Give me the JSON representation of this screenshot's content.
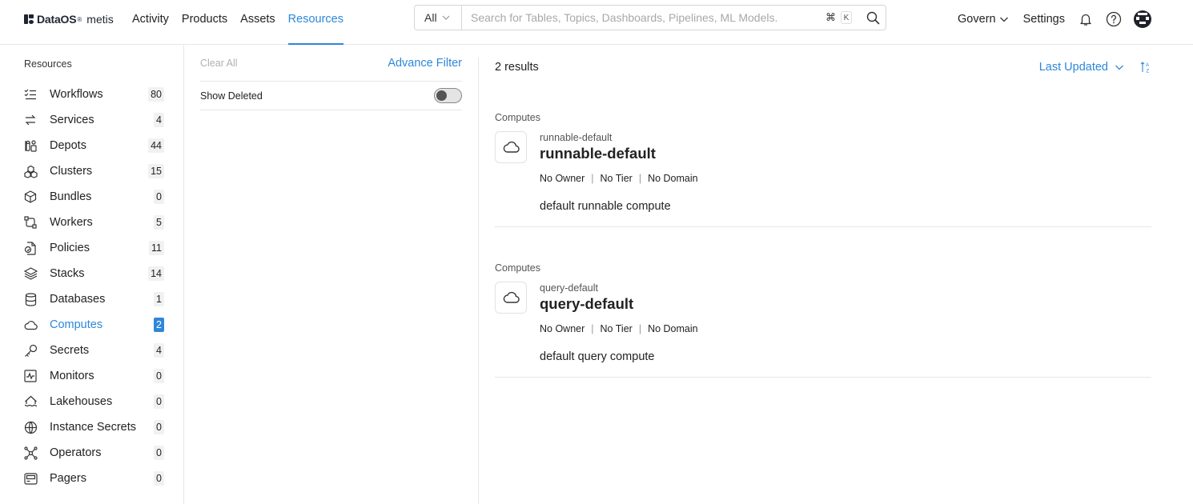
{
  "brand": {
    "name": "DataOS",
    "reg": "®",
    "product": "metis"
  },
  "nav": {
    "items": [
      "Activity",
      "Products",
      "Assets",
      "Resources"
    ],
    "active": "Resources"
  },
  "search": {
    "scope": "All",
    "placeholder": "Search for Tables, Topics, Dashboards, Pipelines, ML Models.",
    "shortcut_cmd": "⌘",
    "shortcut_key": "K"
  },
  "header": {
    "govern_label": "Govern",
    "settings_label": "Settings"
  },
  "sidebar": {
    "title": "Resources",
    "items": [
      {
        "label": "Workflows",
        "count": "80",
        "icon": "workflow-icon"
      },
      {
        "label": "Services",
        "count": "4",
        "icon": "service-icon"
      },
      {
        "label": "Depots",
        "count": "44",
        "icon": "depot-icon"
      },
      {
        "label": "Clusters",
        "count": "15",
        "icon": "cluster-icon"
      },
      {
        "label": "Bundles",
        "count": "0",
        "icon": "bundle-icon"
      },
      {
        "label": "Workers",
        "count": "5",
        "icon": "worker-icon"
      },
      {
        "label": "Policies",
        "count": "11",
        "icon": "policy-icon"
      },
      {
        "label": "Stacks",
        "count": "14",
        "icon": "stack-icon"
      },
      {
        "label": "Databases",
        "count": "1",
        "icon": "database-icon"
      },
      {
        "label": "Computes",
        "count": "2",
        "icon": "compute-icon",
        "active": true
      },
      {
        "label": "Secrets",
        "count": "4",
        "icon": "secret-icon"
      },
      {
        "label": "Monitors",
        "count": "0",
        "icon": "monitor-icon"
      },
      {
        "label": "Lakehouses",
        "count": "0",
        "icon": "lakehouse-icon"
      },
      {
        "label": "Instance Secrets",
        "count": "0",
        "icon": "instance-secret-icon"
      },
      {
        "label": "Operators",
        "count": "0",
        "icon": "operator-icon"
      },
      {
        "label": "Pagers",
        "count": "0",
        "icon": "pager-icon"
      }
    ]
  },
  "filter": {
    "clear_all": "Clear All",
    "advance_filter": "Advance Filter",
    "show_deleted": "Show Deleted",
    "show_deleted_on": false
  },
  "results": {
    "count_label": "2 results",
    "sort_label": "Last Updated",
    "items": [
      {
        "type": "Computes",
        "subname": "runnable-default",
        "name": "runnable-default",
        "owner": "No Owner",
        "tier": "No Tier",
        "domain": "No Domain",
        "description": "default runnable compute"
      },
      {
        "type": "Computes",
        "subname": "query-default",
        "name": "query-default",
        "owner": "No Owner",
        "tier": "No Tier",
        "domain": "No Domain",
        "description": "default query compute"
      }
    ]
  },
  "colors": {
    "accent": "#2e87d8",
    "border": "#e6e6e6"
  }
}
